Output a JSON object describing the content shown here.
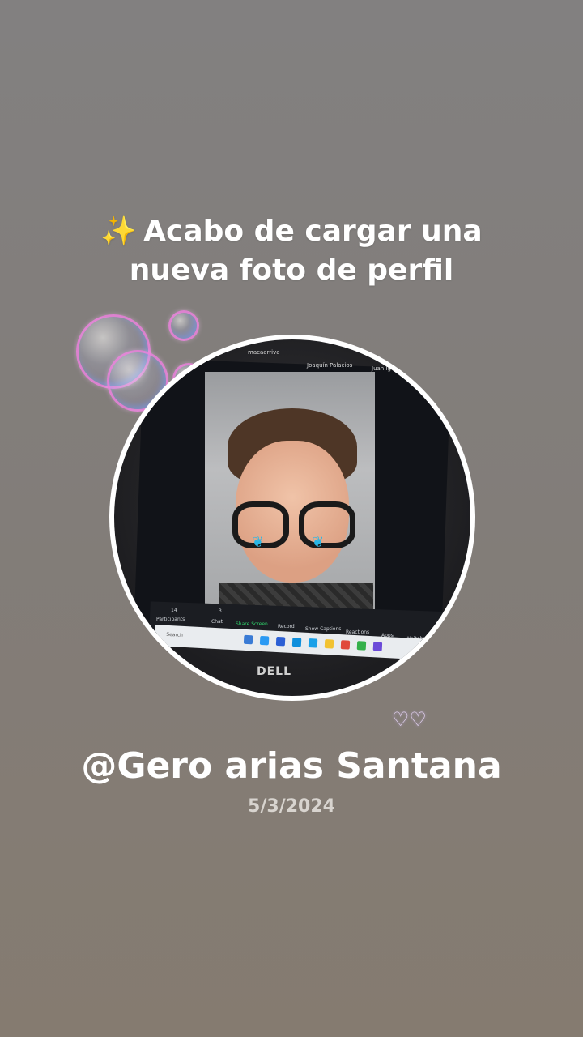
{
  "headline": {
    "sparkle_icon": "sparkles-icon",
    "line1": "Acabo de cargar una",
    "line2": "nueva foto de perfil"
  },
  "photo": {
    "tile_names": [
      "macaarriva",
      "Joaquín Palacios",
      "Juan Ig"
    ],
    "zoom_toolbar": [
      "Participants",
      "Chat",
      "Share Screen",
      "Record",
      "Show Captions",
      "Reactions",
      "Apps",
      "Whitebo"
    ],
    "participants_count": "14",
    "chat_badge": "3",
    "taskbar_search": "Search",
    "brand": "DELL"
  },
  "hearts_icon": "hearts-icon",
  "profile": {
    "name": "@Gero arias Santana",
    "date": "5/3/2024"
  }
}
